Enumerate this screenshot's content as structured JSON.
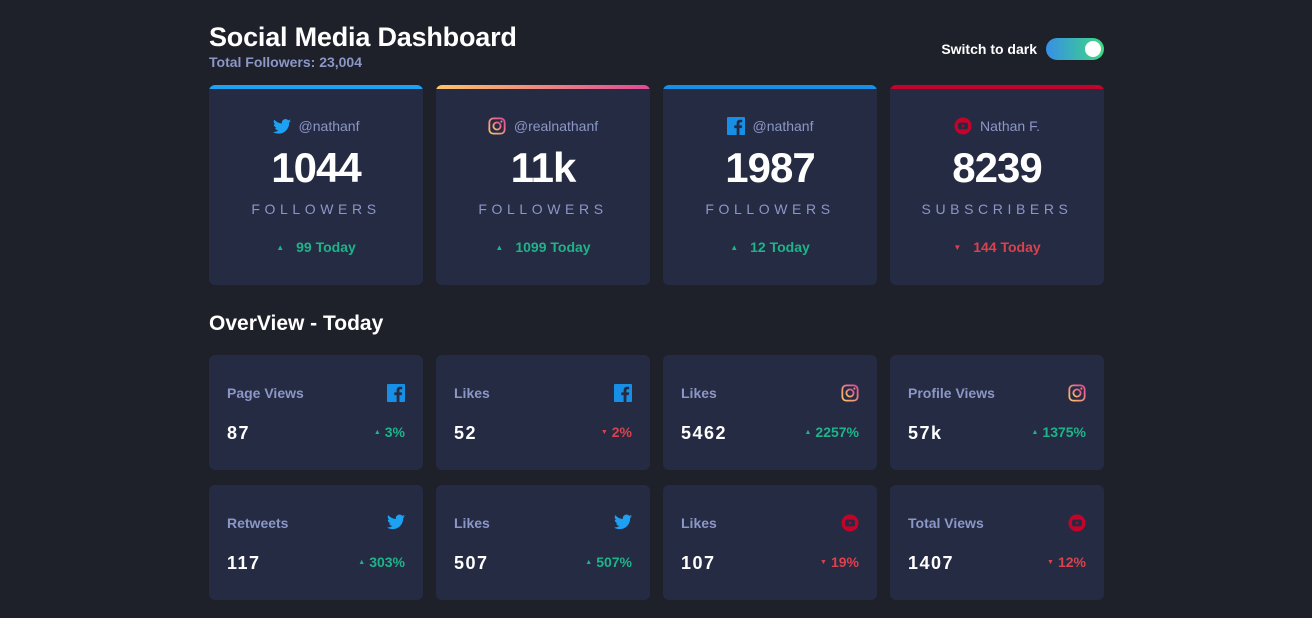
{
  "header": {
    "title": "Social Media Dashboard",
    "subtitle": "Total Followers: 23,004",
    "toggle_label": "Switch to dark"
  },
  "colors": {
    "background": "#1e202a",
    "card": "#252b43",
    "up": "#1db489",
    "down": "#dc414c",
    "twitter": "#1da1f2",
    "facebook": "#178fe6",
    "youtube": "#c4032a",
    "instagram_gradient": [
      "#fdc468",
      "#df4996"
    ]
  },
  "followers": [
    {
      "platform": "twitter",
      "icon": "twitter-icon",
      "handle": "@nathanf",
      "count": "1044",
      "unit": "FOLLOWERS",
      "direction": "up",
      "delta": "99 Today"
    },
    {
      "platform": "instagram",
      "icon": "instagram-icon",
      "handle": "@realnathanf",
      "count": "11k",
      "unit": "FOLLOWERS",
      "direction": "up",
      "delta": "1099 Today"
    },
    {
      "platform": "facebook",
      "icon": "facebook-icon",
      "handle": "@nathanf",
      "count": "1987",
      "unit": "FOLLOWERS",
      "direction": "up",
      "delta": "12 Today"
    },
    {
      "platform": "youtube",
      "icon": "youtube-icon",
      "handle": "Nathan F.",
      "count": "8239",
      "unit": "SUBSCRIBERS",
      "direction": "down",
      "delta": "144 Today"
    }
  ],
  "overview": {
    "title": "OverView - Today",
    "items": [
      {
        "label": "Page Views",
        "platform": "facebook",
        "value": "87",
        "direction": "up",
        "delta": "3%"
      },
      {
        "label": "Likes",
        "platform": "facebook",
        "value": "52",
        "direction": "down",
        "delta": "2%"
      },
      {
        "label": "Likes",
        "platform": "instagram",
        "value": "5462",
        "direction": "up",
        "delta": "2257%"
      },
      {
        "label": "Profile Views",
        "platform": "instagram",
        "value": "57k",
        "direction": "up",
        "delta": "1375%"
      },
      {
        "label": "Retweets",
        "platform": "twitter",
        "value": "117",
        "direction": "up",
        "delta": "303%"
      },
      {
        "label": "Likes",
        "platform": "twitter",
        "value": "507",
        "direction": "up",
        "delta": "507%"
      },
      {
        "label": "Likes",
        "platform": "youtube",
        "value": "107",
        "direction": "down",
        "delta": "19%"
      },
      {
        "label": "Total Views",
        "platform": "youtube",
        "value": "1407",
        "direction": "down",
        "delta": "12%"
      }
    ]
  }
}
